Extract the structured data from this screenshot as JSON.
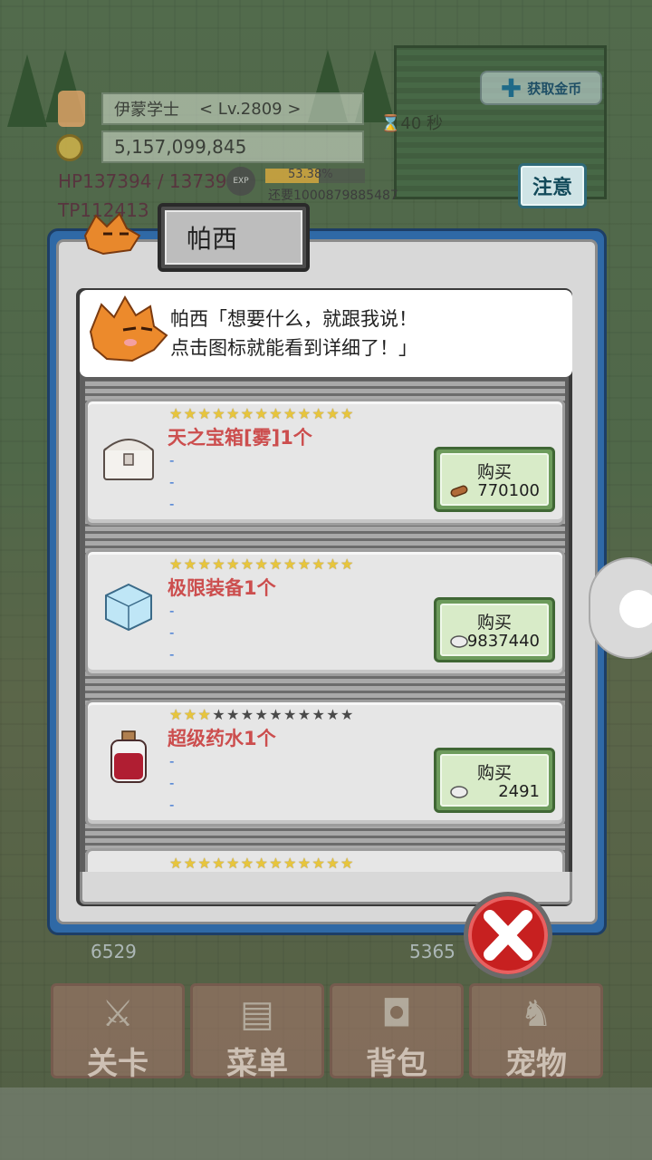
{
  "player": {
    "name": "伊蒙学士",
    "level": "< Lv.2809 >",
    "gold": "5,157,099,845",
    "hp": "137394 / 13739",
    "tp": "112413",
    "exp_percent": "53.38%",
    "exp_fraction": 0.5338,
    "exp_needed": "还要1000879885487",
    "timer": "40 秒"
  },
  "hud": {
    "get_gold_label": "获取金币",
    "notice_button": "注意"
  },
  "shop": {
    "tab_title": "帕西",
    "npc_line1": "帕西「想要什么，就跟我说！",
    "npc_line2": "点击图标就能看到详细了！」",
    "buy_label": "购买",
    "items": [
      {
        "name": "天之宝箱[雾]1个",
        "stars_on": 13,
        "stars_total": 13,
        "price": "770100",
        "currency": "wood-icon",
        "icon": "treasure-chest-icon"
      },
      {
        "name": "极限装备1个",
        "stars_on": 13,
        "stars_total": 13,
        "price": "9837440",
        "currency": "stone-icon",
        "icon": "crystal-cube-icon"
      },
      {
        "name": "超级药水1个",
        "stars_on": 3,
        "stars_total": 13,
        "price": "2491",
        "currency": "stone-icon",
        "icon": "potion-bottle-icon"
      },
      {
        "name": "",
        "stars_on": 13,
        "stars_total": 13,
        "price": "",
        "currency": "",
        "icon": ""
      }
    ],
    "dash": "-"
  },
  "nav": {
    "stage": "关卡",
    "menu": "菜单",
    "bag": "背包",
    "pet": "宠物"
  },
  "faded_numbers": {
    "left": "6529",
    "right": "5365"
  },
  "colors": {
    "panel_blue": "#2f69a6",
    "item_name_red": "#cc4e4e",
    "buy_green": "#6d9b5c",
    "close_red": "#c72020",
    "star_gold": "#e7c53c"
  }
}
